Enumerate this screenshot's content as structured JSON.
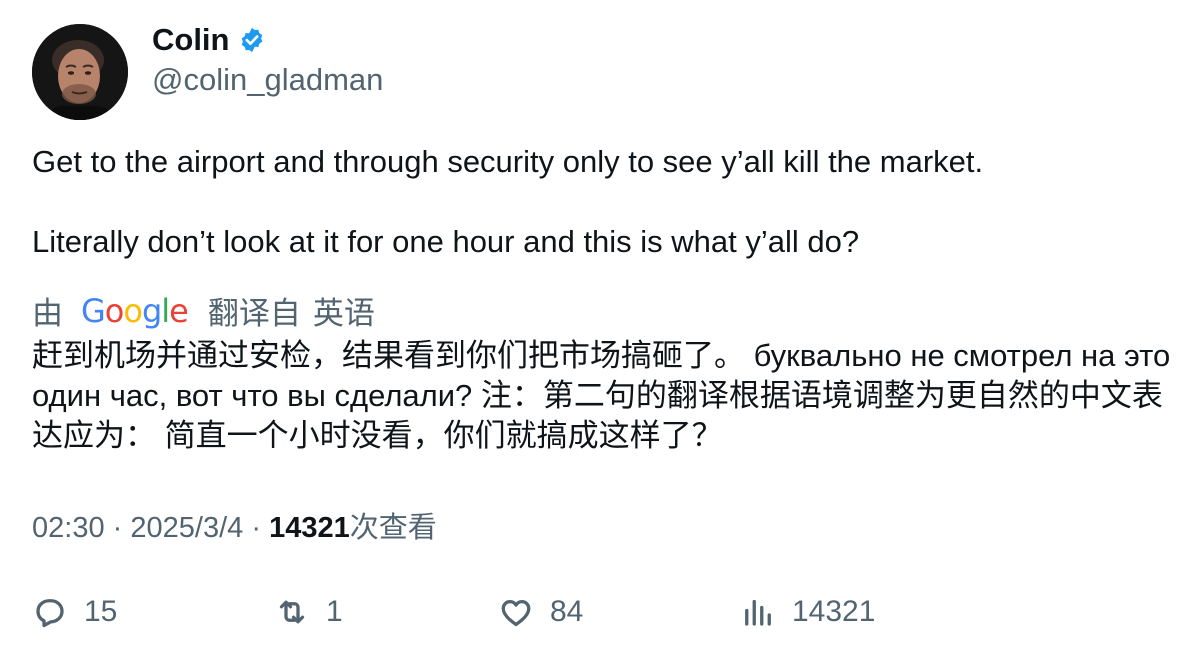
{
  "author": {
    "name": "Colin",
    "handle": "@colin_gladman",
    "verified_color": "#1d9bf0"
  },
  "tweet": {
    "lines": [
      "Get to the airport and through security only to see y’all kill the market.",
      "Literally don’t look at it for one hour and this is what y’all do?"
    ]
  },
  "translation": {
    "by_prefix": "由",
    "provider": "Google",
    "translated_from": "翻译自",
    "language": "英语",
    "text": "赶到机场并通过安检，结果看到你们把市场搞砸了。 буквально не смотрел на это один час, вот что вы сделали? 注：第二句的翻译根据语境调整为更自然的中文表达应为： 简直一个小时没看，你们就搞成这样了？"
  },
  "meta": {
    "time": "02:30",
    "separator": "·",
    "date": "2025/3/4",
    "views_count": "14321",
    "views_label": "次查看"
  },
  "actions": {
    "replies": "15",
    "retweets": "1",
    "likes": "84",
    "views": "14321"
  },
  "colors": {
    "text": "#0f1419",
    "secondary": "#536471",
    "google_blue": "#4285f4",
    "google_red": "#ea4335",
    "google_yellow": "#fbbc05",
    "google_green": "#34a853"
  },
  "icons": [
    "verified-badge-icon",
    "reply-icon",
    "retweet-icon",
    "like-icon",
    "views-icon"
  ]
}
